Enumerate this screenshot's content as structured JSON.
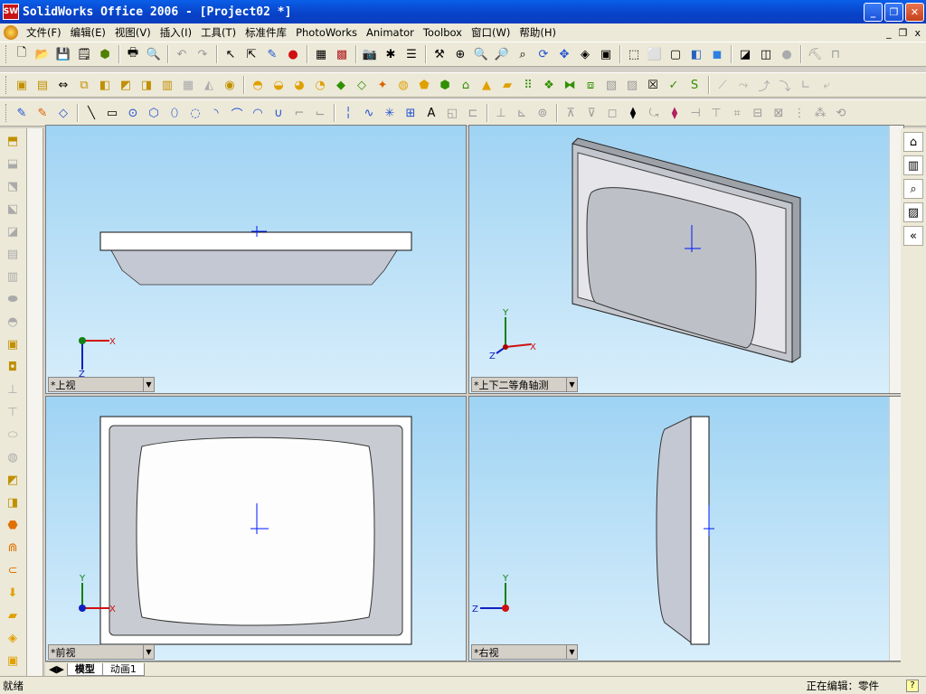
{
  "window": {
    "title": "SolidWorks Office 2006 - [Project02 *]",
    "logo": "SW"
  },
  "menu": {
    "items": [
      "文件(F)",
      "编辑(E)",
      "视图(V)",
      "插入(I)",
      "工具(T)",
      "标准件库",
      "PhotoWorks",
      "Animator",
      "Toolbox",
      "窗口(W)",
      "帮助(H)"
    ],
    "right": [
      "_",
      "❐",
      "x"
    ]
  },
  "viewports": {
    "top": {
      "label": "*上视",
      "triad": {
        "x": "X",
        "z": "Z"
      }
    },
    "iso": {
      "label": "*上下二等角轴测",
      "triad": {
        "x": "X",
        "y": "Y",
        "z": "Z"
      }
    },
    "front": {
      "label": "*前视",
      "triad": {
        "x": "X",
        "y": "Y"
      }
    },
    "right": {
      "label": "*右视",
      "triad": {
        "y": "Y",
        "z": "Z"
      }
    }
  },
  "tabs": [
    {
      "label": "模型"
    },
    {
      "label": "动画1"
    }
  ],
  "status": {
    "left": "就绪",
    "right": "正在编辑：零件",
    "help": "?"
  },
  "colors": {
    "title_bar": "#0842c8",
    "viewport_bg": "#9fd3f3",
    "axis_x": "#d01010",
    "axis_y": "#128012",
    "axis_z": "#1020c0",
    "sketch_blue": "#0018ff"
  }
}
